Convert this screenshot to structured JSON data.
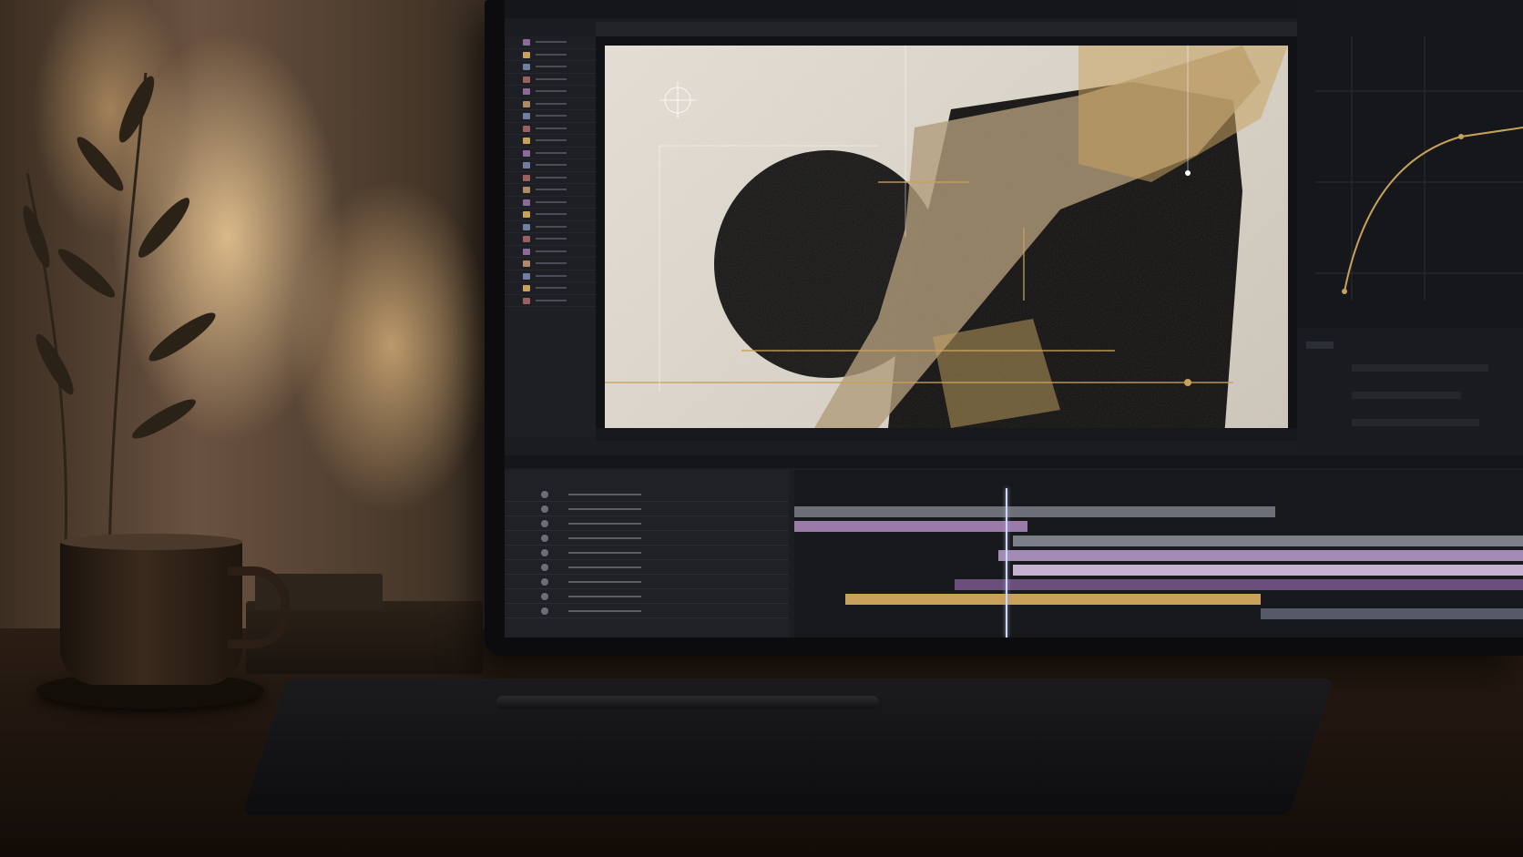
{
  "scene": {
    "description_colors": {
      "wall_light": "#e9c996",
      "desk": "#1c130d",
      "accent_gold": "#c8a15a",
      "accent_purple": "#8a6b9a",
      "screen_bg": "#1b1c20"
    }
  },
  "app": {
    "menu": [],
    "tabs": [],
    "timeline_tabs": []
  },
  "timeline": {
    "tracks": [
      {
        "color": "#6d6f78",
        "start": 0,
        "end": 0.66
      },
      {
        "color": "#9a7aa8",
        "start": 0,
        "end": 0.32
      },
      {
        "color": "#7a7f8a",
        "start": 0.3,
        "end": 1.0
      },
      {
        "color": "#a28ab5",
        "start": 0.28,
        "end": 1.0
      },
      {
        "color": "#c5b0d0",
        "start": 0.3,
        "end": 1.0
      },
      {
        "color": "#6a4f7c",
        "start": 0.22,
        "end": 1.0
      },
      {
        "color": "#c8a15a",
        "start": 0.07,
        "end": 0.64
      },
      {
        "color": "#555a66",
        "start": 0.64,
        "end": 1.0
      }
    ],
    "playhead": 0.29
  }
}
